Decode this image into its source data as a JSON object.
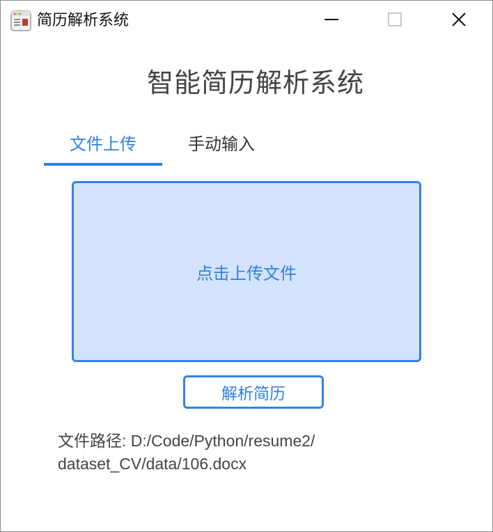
{
  "window": {
    "title": "简历解析系统",
    "app_icon": "app-window-icon",
    "controls": {
      "minimize_icon": "minimize-icon",
      "maximize_icon": "maximize-icon",
      "close_icon": "close-icon"
    }
  },
  "main": {
    "heading": "智能简历解析系统",
    "tabs": [
      {
        "label": "文件上传",
        "active": true
      },
      {
        "label": "手动输入",
        "active": false
      }
    ],
    "upload": {
      "label": "点击上传文件"
    },
    "parse_button": "解析简历",
    "file_path": {
      "line1": "文件路径: D:/Code/Python/resume2/",
      "line2": "dataset_CV/data/106.docx"
    }
  },
  "colors": {
    "accent": "#2f7fe4",
    "dropzone_bg": "#d3e3fb",
    "text_dark": "#444444"
  }
}
